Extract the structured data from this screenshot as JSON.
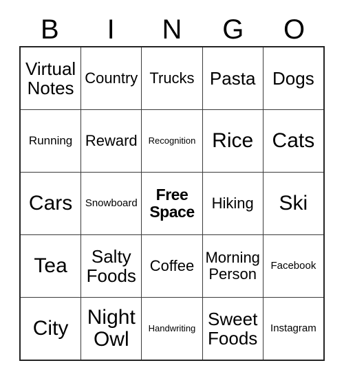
{
  "card": {
    "header_letters": [
      "B",
      "I",
      "N",
      "G",
      "O"
    ],
    "rows": [
      [
        {
          "text": "Virtual Notes",
          "size": "t-lg",
          "free": false
        },
        {
          "text": "Country",
          "size": "t-md",
          "free": false
        },
        {
          "text": "Trucks",
          "size": "t-md",
          "free": false
        },
        {
          "text": "Pasta",
          "size": "t-lg",
          "free": false
        },
        {
          "text": "Dogs",
          "size": "t-lg",
          "free": false
        }
      ],
      [
        {
          "text": "Running",
          "size": "t-sm",
          "free": false
        },
        {
          "text": "Reward",
          "size": "t-md",
          "free": false
        },
        {
          "text": "Recognition",
          "size": "t-xxs",
          "free": false
        },
        {
          "text": "Rice",
          "size": "t-xl",
          "free": false
        },
        {
          "text": "Cats",
          "size": "t-xl",
          "free": false
        }
      ],
      [
        {
          "text": "Cars",
          "size": "t-xl",
          "free": false
        },
        {
          "text": "Snowboard",
          "size": "t-xs",
          "free": false
        },
        {
          "text": "Free Space",
          "size": "free",
          "free": true
        },
        {
          "text": "Hiking",
          "size": "t-md",
          "free": false
        },
        {
          "text": "Ski",
          "size": "t-xl",
          "free": false
        }
      ],
      [
        {
          "text": "Tea",
          "size": "t-xl",
          "free": false
        },
        {
          "text": "Salty Foods",
          "size": "t-lg",
          "free": false
        },
        {
          "text": "Coffee",
          "size": "t-md",
          "free": false
        },
        {
          "text": "Morning Person",
          "size": "t-md",
          "free": false
        },
        {
          "text": "Facebook",
          "size": "t-xs",
          "free": false
        }
      ],
      [
        {
          "text": "City",
          "size": "t-xl",
          "free": false
        },
        {
          "text": "Night Owl",
          "size": "t-xl",
          "free": false
        },
        {
          "text": "Handwriting",
          "size": "t-xxs",
          "free": false
        },
        {
          "text": "Sweet Foods",
          "size": "t-lg",
          "free": false
        },
        {
          "text": "Instagram",
          "size": "t-xs",
          "free": false
        }
      ]
    ],
    "colors": {
      "background": "#ffffff",
      "text": "#000000",
      "outer_border": "#222222",
      "inner_border": "#3a3a3a"
    }
  }
}
